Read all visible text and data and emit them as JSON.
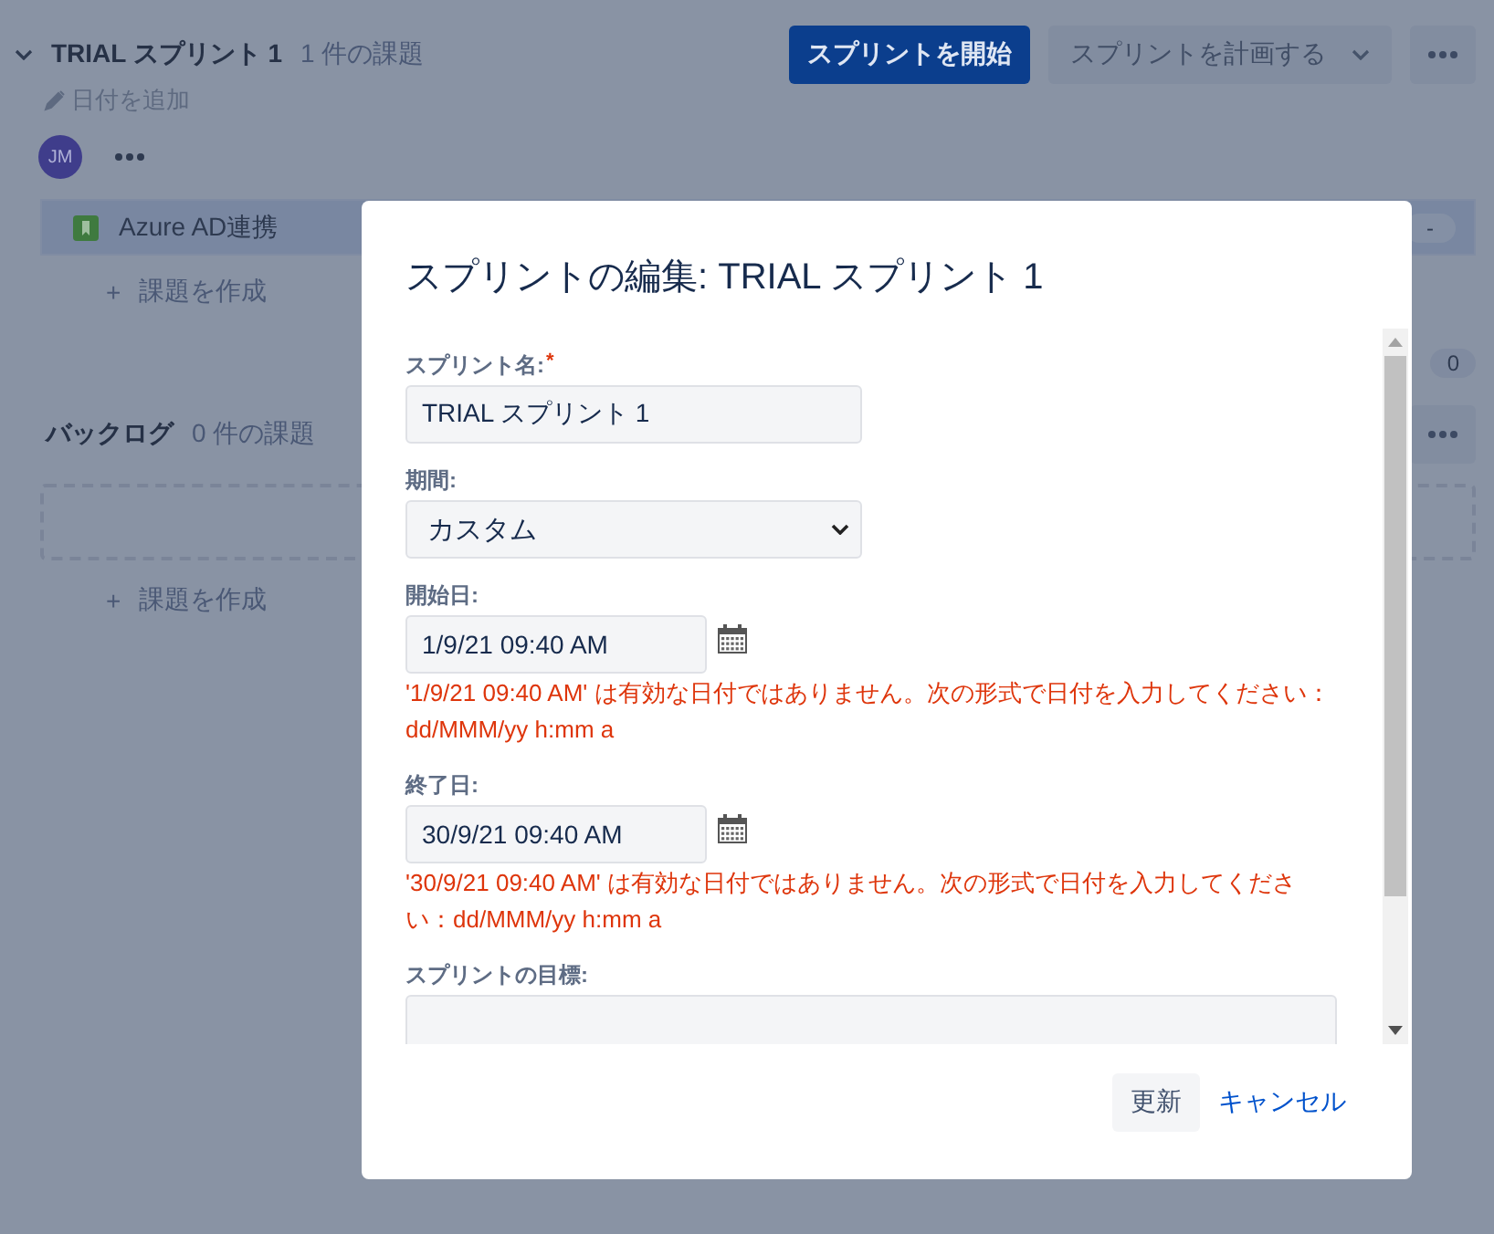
{
  "sprint": {
    "title": "TRIAL スプリント 1",
    "issue_count": "1 件の課題",
    "add_date": "日付を追加",
    "avatar": "JM",
    "start_button": "スプリントを開始",
    "plan_button": "スプリントを計画する",
    "issues": [
      {
        "summary": "Azure AD連携",
        "estimate": "-"
      }
    ],
    "create_icon": "+",
    "create_issue": "課題を作成",
    "points": "0"
  },
  "backlog": {
    "title": "バックログ",
    "issue_count": "0 件の課題",
    "create_icon": "+",
    "create_issue": "課題を作成"
  },
  "dialog": {
    "title": "スプリントの編集: TRIAL スプリント 1",
    "fields": [
      {
        "kind": "text",
        "label": "スプリント名:",
        "required_mark": "*",
        "value": "TRIAL スプリント 1"
      },
      {
        "kind": "select",
        "label": "期間:",
        "value": "カスタム"
      },
      {
        "kind": "date",
        "label": "開始日:",
        "value": "1/9/21 09:40 AM",
        "error": "'1/9/21 09:40 AM' は有効な日付ではありません。次の形式で日付を入力してください：dd/MMM/yy h:mm a"
      },
      {
        "kind": "date",
        "label": "終了日:",
        "value": "30/9/21 09:40 AM",
        "error": "'30/9/21 09:40 AM' は有効な日付ではありません。次の形式で日付を入力してください：dd/MMM/yy h:mm a"
      },
      {
        "kind": "textarea",
        "label": "スプリントの目標:"
      }
    ],
    "buttons": [
      {
        "kind": "subtle",
        "label": "更新"
      },
      {
        "kind": "link",
        "label": "キャンセル"
      }
    ]
  }
}
